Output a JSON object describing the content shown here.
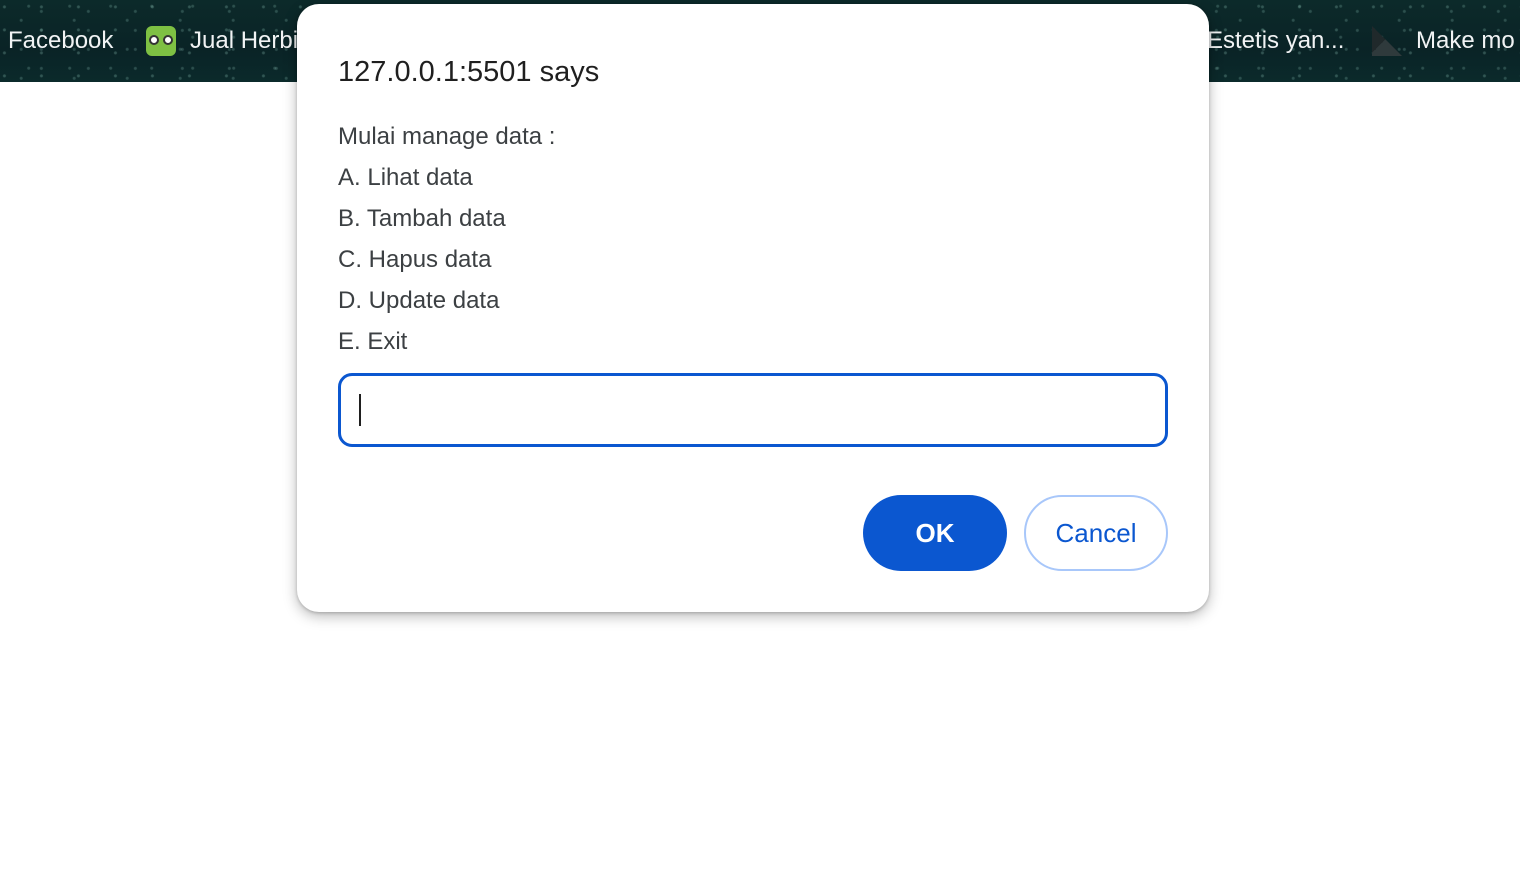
{
  "bookmarks_bar": {
    "items": [
      {
        "label": "Facebook",
        "icon": "facebook-icon"
      },
      {
        "label": "Jual Herbi",
        "icon": "owl-icon"
      },
      {
        "label": "Estetis yan...",
        "icon": "none"
      },
      {
        "label": "Make mo",
        "icon": "m-logo-icon"
      }
    ]
  },
  "dialog": {
    "title": "127.0.0.1:5501 says",
    "message_lines": [
      "Mulai manage data :",
      "A. Lihat data",
      "B. Tambah data",
      "C. Hapus data",
      "D. Update data",
      "E. Exit"
    ],
    "input_value": "",
    "ok_label": "OK",
    "cancel_label": "Cancel"
  },
  "colors": {
    "accent": "#0b57d0",
    "cancel_border": "#a8c7fa",
    "bookmarks_bg": "#0c2a2a"
  }
}
